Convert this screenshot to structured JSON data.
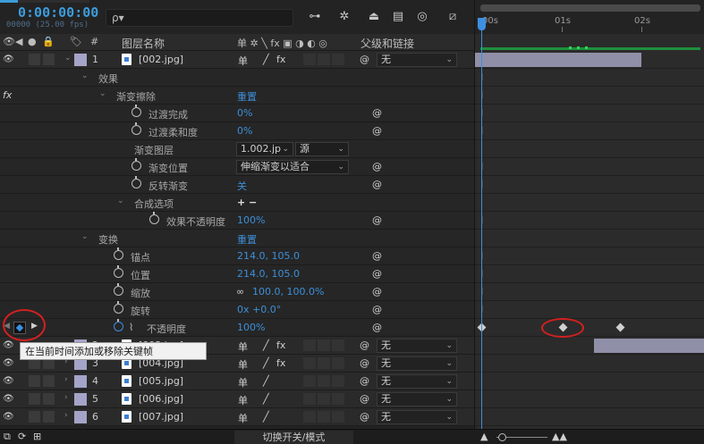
{
  "timecode": {
    "value": "0:00:00:00",
    "sub": "00000 (25.00 fps)"
  },
  "search": {
    "placeholder": "ρ▾"
  },
  "columns": {
    "layer_name": "图层名称",
    "parent": "父级和链接"
  },
  "ruler": {
    "ticks": [
      "00s",
      "01s",
      "02s"
    ]
  },
  "layers": [
    {
      "num": "1",
      "name": "[002.jpg]",
      "parent": "无"
    },
    {
      "num": "2",
      "name": "[003.jpg]",
      "parent": "无"
    },
    {
      "num": "3",
      "name": "[004.jpg]",
      "parent": "无"
    },
    {
      "num": "4",
      "name": "[005.jpg]",
      "parent": "无"
    },
    {
      "num": "5",
      "name": "[006.jpg]",
      "parent": "无"
    },
    {
      "num": "6",
      "name": "[007.jpg]",
      "parent": "无"
    }
  ],
  "props": {
    "effects": "效果",
    "gradient_wipe": "渐变擦除",
    "reset": "重置",
    "transition_completion": {
      "label": "过渡完成",
      "value": "0%"
    },
    "transition_softness": {
      "label": "过渡柔和度",
      "value": "0%"
    },
    "gradient_layer": {
      "label": "渐变图层",
      "value": "1.002.jp",
      "source": "源"
    },
    "gradient_placement": {
      "label": "渐变位置",
      "value": "伸缩渐变以适合"
    },
    "invert_gradient": {
      "label": "反转渐变",
      "value": "关"
    },
    "compositing": {
      "label": "合成选项",
      "value": "+ −"
    },
    "effect_opacity": {
      "label": "效果不透明度",
      "value": "100%"
    },
    "transform": "变换",
    "reset2": "重置",
    "anchor": {
      "label": "锚点",
      "value": "214.0, 105.0"
    },
    "position": {
      "label": "位置",
      "value": "214.0, 105.0"
    },
    "scale": {
      "label": "缩放",
      "value": "100.0, 100.0%"
    },
    "rotation": {
      "label": "旋转",
      "value": "0x +0.0°"
    },
    "opacity": {
      "label": "不透明度",
      "value": "100%"
    }
  },
  "fx_label": "fx",
  "tooltip": "在当前时间添加或移除关键帧",
  "bottom": {
    "switch_label": "切换开关/模式"
  }
}
